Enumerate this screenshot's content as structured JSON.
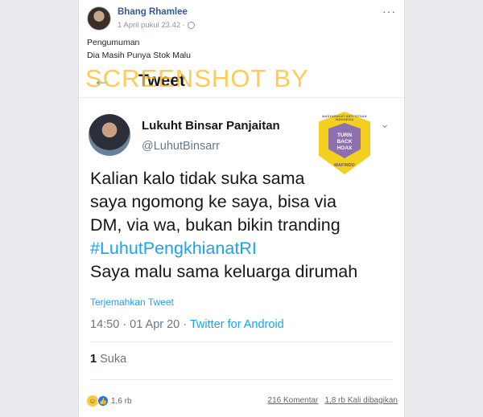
{
  "post": {
    "author": "Bhang Rhamlee",
    "timestamp": "1 April pukul 23.42 ·",
    "caption_line1": "Pengumuman",
    "caption_line2": "Dia Masih Punya Stok Malu",
    "more_icon": "···"
  },
  "screenshot": {
    "watermark": "SCREENSHOT BY",
    "header_title": "Tweet",
    "back_icon": "←",
    "badge": {
      "top_text": "MASYARAKAT ANTI FITNAH INDONESIA",
      "line1": "TURN",
      "line2": "BACK",
      "line3": "HOAX",
      "bottom_text": "MAFINDO"
    },
    "tweet": {
      "name": "Lukuht Binsar Panjaitan",
      "handle": "@LuhutBinsarr",
      "text_line1": "Kalian kalo tidak suka sama",
      "text_line2": "saya ngomong ke saya, bisa via",
      "text_line3": "DM, via wa, bukan bikin tranding",
      "hashtag": "#LuhutPengkhianatRI",
      "text_line5": "Saya malu sama keluarga dirumah",
      "translate": "Terjemahkan Tweet",
      "time": "14:50 · 01 Apr 20 · ",
      "client": "Twitter for Android",
      "likes_count": "1",
      "likes_label": "Suka"
    }
  },
  "footer": {
    "reaction_count": "1,6 rb",
    "comments": "216 Komentar",
    "shares": "1,8 rb Kali dibagikan"
  }
}
